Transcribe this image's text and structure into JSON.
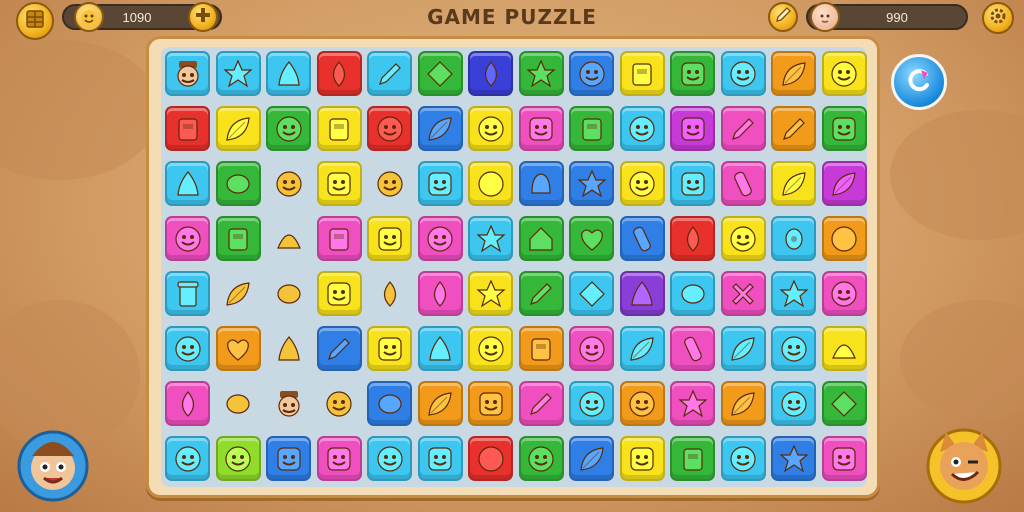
{
  "header": {
    "title": "GAME PUZZLE",
    "coins": "1090",
    "score": "990"
  },
  "icons": {
    "menu": "menu-grid-icon",
    "coin": "coin-face-icon",
    "add": "plus-icon",
    "pencil": "pencil-icon",
    "player": "player-face-icon",
    "settings": "gear-icon",
    "refresh": "refresh-arrow-icon"
  },
  "colors": {
    "cyan": "#3cc6f0",
    "blue": "#2f7fe6",
    "navy": "#3a3fd8",
    "green": "#35b83a",
    "lime": "#8fdc2a",
    "yellow": "#f7e21c",
    "orange": "#f29a1a",
    "red": "#e8312c",
    "pink": "#f04fc0",
    "magenta": "#c83ad8",
    "purple": "#8a3ed8",
    "tan": "#f3cf8a"
  },
  "tiles": [
    [
      "cyan:face-hat",
      "cyan:star",
      "cyan:cone",
      "red:drop",
      "cyan:pencil",
      "green:diamond",
      "navy:drop",
      "green:star",
      "blue:smile",
      "yellow:box",
      "green:face",
      "cyan:smile",
      "orange:leaf",
      "yellow:smile"
    ],
    [
      "red:box",
      "yellow:leaf",
      "green:smile",
      "yellow:box",
      "red:smile",
      "blue:leaf",
      "yellow:smile",
      "pink:face",
      "green:box",
      "cyan:smile",
      "magenta:face",
      "pink:pencil",
      "orange:pencil",
      "green:face"
    ],
    [
      "cyan:cone",
      "green:egg",
      "empty:smile",
      "yellow:face",
      "empty:smile",
      "cyan:face",
      "yellow:circle",
      "blue:bell",
      "blue:star",
      "yellow:smile",
      "cyan:face",
      "pink:bottle",
      "yellow:leaf",
      "magenta:leaf"
    ],
    [
      "pink:smile",
      "green:box",
      "empty:shell",
      "pink:box",
      "yellow:face",
      "pink:smile",
      "cyan:star",
      "green:house",
      "green:heart",
      "blue:bottle",
      "red:drop",
      "yellow:smile",
      "cyan:candy",
      "orange:circle"
    ],
    [
      "cyan:can",
      "empty:leaf",
      "empty:egg",
      "yellow:face",
      "empty:drop",
      "pink:drop",
      "yellow:star",
      "green:pencil",
      "cyan:diamond",
      "purple:cone",
      "cyan:egg",
      "pink:x",
      "cyan:star",
      "pink:smile"
    ],
    [
      "cyan:smile",
      "orange:heart",
      "empty:cone",
      "blue:pencil",
      "yellow:face",
      "cyan:cone",
      "yellow:smile",
      "orange:box",
      "pink:smile",
      "cyan:leaf",
      "pink:bottle",
      "cyan:leaf",
      "cyan:smile",
      "yellow:shell"
    ],
    [
      "pink:drop",
      "empty:egg",
      "empty:face-hat",
      "empty:smile",
      "blue:egg",
      "orange:leaf",
      "orange:face",
      "pink:pencil",
      "cyan:smile",
      "orange:smile",
      "pink:star",
      "orange:leaf",
      "cyan:smile",
      "green:diamond"
    ],
    [
      "cyan:smile",
      "lime:smile",
      "blue:face",
      "pink:face",
      "cyan:smile",
      "cyan:face",
      "red:circle",
      "green:smile",
      "blue:leaf",
      "yellow:face",
      "green:box",
      "cyan:smile",
      "blue:star",
      "pink:face"
    ]
  ]
}
